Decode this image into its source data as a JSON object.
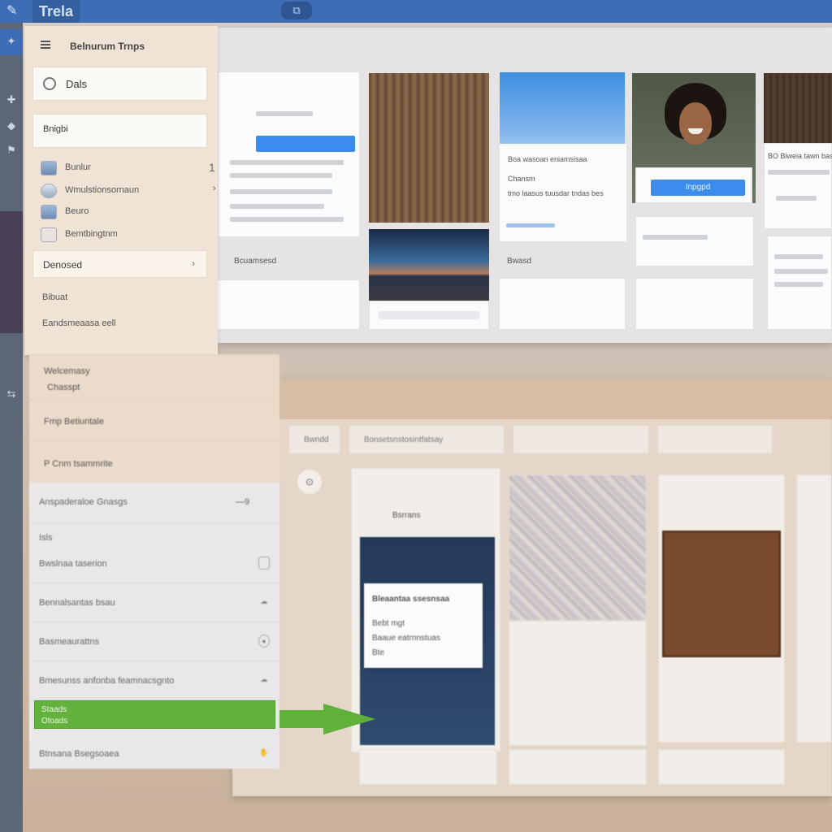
{
  "app": {
    "title": "Trela"
  },
  "sidebar": {
    "title": "Belnurum Trnps",
    "primary_button": "Dals",
    "secondary_button": "Bnigbi",
    "marker": "1",
    "items": [
      {
        "label": "Bunlur"
      },
      {
        "label": "Wmulstionsornaun",
        "arrow": "›"
      },
      {
        "label": "Beuro"
      },
      {
        "label": "Bemtbingtnm"
      }
    ],
    "dropdown_label": "Denosed",
    "text_lines": [
      "Bibuat",
      "Eandsmeaasa eell"
    ]
  },
  "sidebar_lower": {
    "rows": [
      {
        "line1": "Welcemasy",
        "line2": "Chasspt"
      },
      {
        "line1": "Fmp Betiuntale"
      },
      {
        "line1": "P Cnm tsammrite"
      }
    ]
  },
  "settings_panel": {
    "header": "Anspaderaloe Gnasgs",
    "header_value": "—9",
    "section_label": "Isls",
    "rows": [
      {
        "label": "Bwslnaa taserion"
      },
      {
        "label": "Bennalsantas bsau"
      },
      {
        "label": "Basmeaurattns"
      },
      {
        "label": "Bmesunss anfonba feamnacsgnto"
      }
    ],
    "highlighted": {
      "line1": "Staads",
      "line2": "Otoads"
    },
    "last_row": "Btnsana Bsegsoaea"
  },
  "gallery": {
    "cards": [
      {
        "caption": "Bcuamsesd"
      },
      {
        "caption": "Bwasd"
      },
      {
        "headline": "Boa wasoan eniamsisaa",
        "line": "Chansm",
        "body": "tmo laasus tuusdar tndas bes"
      },
      {
        "button": "Inpgpd"
      },
      {
        "headline": "BO Biweia tawn bas"
      }
    ]
  },
  "lower_panel": {
    "tabs": [
      "Bwndd",
      "Bonsetsnstosintfatsay"
    ],
    "card_label": "Bsrrans",
    "popup": {
      "title": "Bleaantaa ssesnsaa",
      "lines": [
        "Bebt mgt",
        "Baaue eatrnnstuas",
        "Bte"
      ]
    }
  },
  "colors": {
    "topbar": "#3f6db5",
    "accent_blue": "#3b8cec",
    "highlight_green": "#63b23d"
  }
}
